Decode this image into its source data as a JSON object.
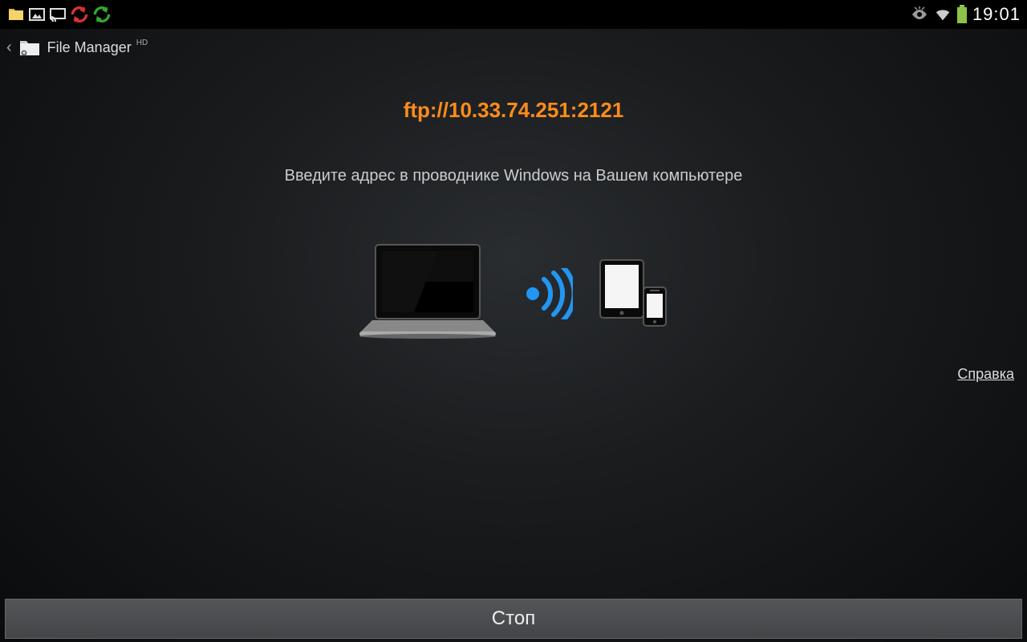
{
  "statusBar": {
    "time": "19:01"
  },
  "appBar": {
    "title": "File Manager",
    "suffix": "HD"
  },
  "main": {
    "ftpAddress": "ftp://10.33.74.251:2121",
    "instruction": "Введите адрес в проводнике Windows на Вашем компьютере"
  },
  "helpLink": "Справка",
  "stopButton": "Стоп",
  "colors": {
    "accent": "#ff8c1a",
    "wifi": "#2196f3"
  }
}
